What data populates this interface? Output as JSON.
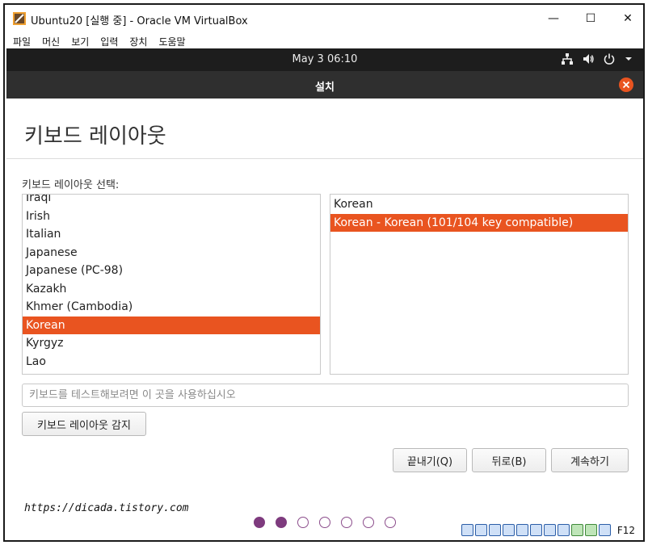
{
  "window": {
    "title": "Ubuntu20 [실행 중] - Oracle VM VirtualBox",
    "minimize_glyph": "—",
    "maximize_glyph": "☐",
    "close_glyph": "✕"
  },
  "menubar": {
    "items": [
      "파일",
      "머신",
      "보기",
      "입력",
      "장치",
      "도움말"
    ]
  },
  "ubuntu_panel": {
    "clock": "May 3  06:10",
    "icons": [
      "network-icon",
      "volume-icon",
      "power-icon",
      "chevron-down-icon"
    ]
  },
  "installer": {
    "header_title": "설치",
    "page_heading": "키보드 레이아웃",
    "select_label": "키보드 레이아웃 선택:",
    "layouts": [
      "Iraqi",
      "Irish",
      "Italian",
      "Japanese",
      "Japanese (PC-98)",
      "Kazakh",
      "Khmer (Cambodia)",
      "Korean",
      "Kyrgyz",
      "Lao"
    ],
    "selected_layout": "Korean",
    "variants": [
      "Korean",
      "Korean - Korean (101/104 key compatible)"
    ],
    "selected_variant": "Korean - Korean (101/104 key compatible)",
    "test_input_placeholder": "키보드를 테스트해보려면 이 곳을 사용하십시오",
    "test_input_value": "",
    "detect_button": "키보드 레이아웃 감지",
    "quit_button": "끝내기(Q)",
    "back_button": "뒤로(B)",
    "continue_button": "계속하기",
    "progress": {
      "total_steps": 7,
      "completed_steps": 2
    },
    "accent_color": "#e95420"
  },
  "watermark": "https://dicada.tistory.com",
  "statusbar": {
    "host_key": "F12"
  }
}
